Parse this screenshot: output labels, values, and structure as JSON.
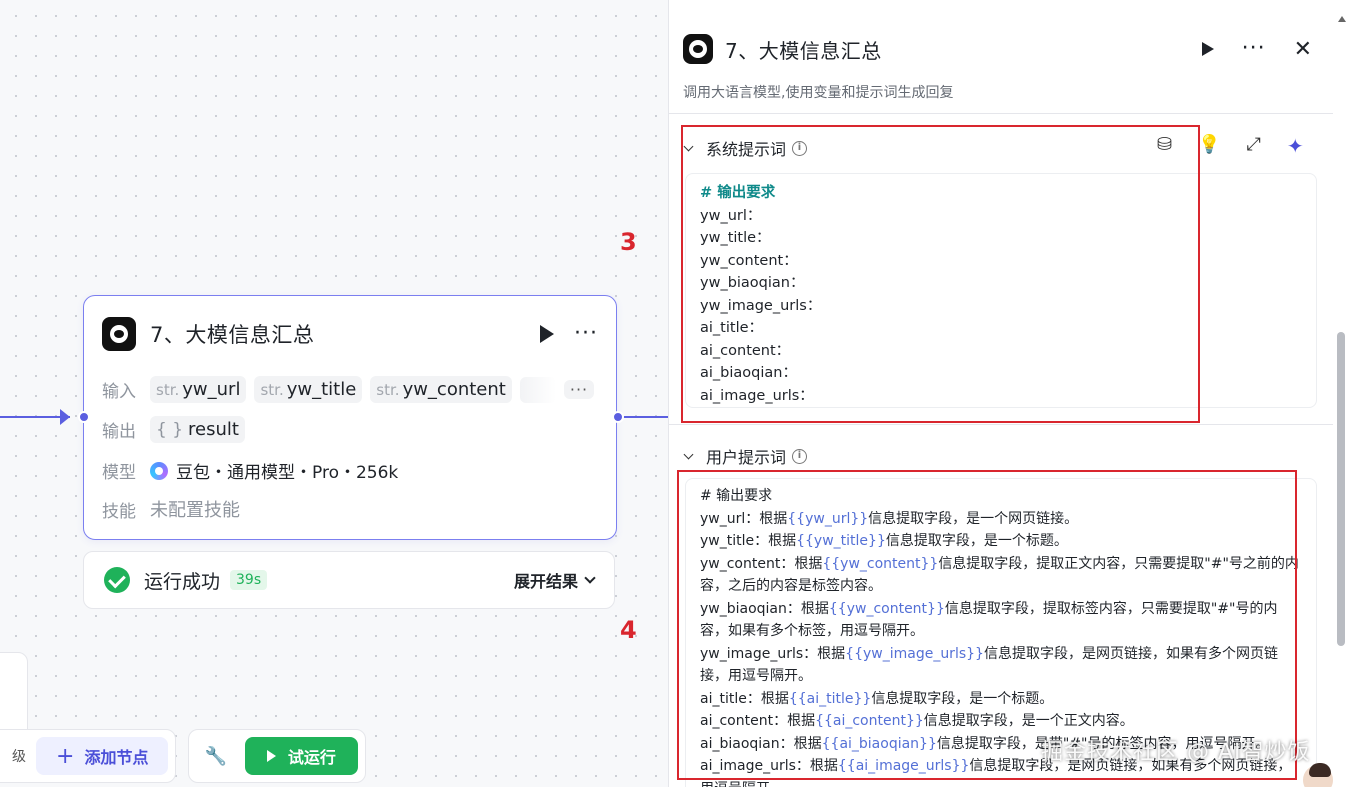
{
  "node": {
    "title": "7、大模信息汇总",
    "input_label": "输入",
    "inputs": [
      {
        "type": "str.",
        "name": "yw_url"
      },
      {
        "type": "str.",
        "name": "yw_title"
      },
      {
        "type": "str.",
        "name": "yw_content"
      }
    ],
    "more_label": "···",
    "output_label": "输出",
    "output": {
      "type": "{ }",
      "name": "result"
    },
    "model_label": "模型",
    "model_value": "豆包・通用模型・Pro・256k",
    "skill_label": "技能",
    "skill_value": "未配置技能"
  },
  "status": {
    "text": "运行成功",
    "time": "39s",
    "expand_label": "展开结果"
  },
  "toolbar": {
    "partial_label": "级",
    "add_node": "添加节点",
    "test_run": "试运行"
  },
  "annotations": {
    "a3": "3",
    "a4": "4"
  },
  "panel": {
    "title": "7、大模信息汇总",
    "description": "调用大语言模型,使用变量和提示词生成回复",
    "system_prompt_label": "系统提示词",
    "system_lines": [
      "# 输出要求",
      "yw_url：",
      "yw_title：",
      "yw_content：",
      "yw_biaoqian：",
      "yw_image_urls：",
      "ai_title：",
      "ai_content：",
      "ai_biaoqian：",
      "ai_image_urls："
    ],
    "user_prompt_label": "用户提示词",
    "user": {
      "l0": "# 输出要求",
      "l1a": "yw_url：根据",
      "l1v": "{{yw_url}}",
      "l1b": "信息提取字段，是一个网页链接。",
      "l2a": "yw_title：根据",
      "l2v": "{{yw_title}}",
      "l2b": "信息提取字段，是一个标题。",
      "l3a": "yw_content：根据",
      "l3v": "{{yw_content}}",
      "l3b": "信息提取字段，提取正文内容，只需要提取\"#\"号之前的内容，之后的内容是标签内容。",
      "l4a": "yw_biaoqian：根据",
      "l4v": "{{yw_content}}",
      "l4b": "信息提取字段，提取标签内容，只需要提取\"#\"号的内容，如果有多个标签，用逗号隔开。",
      "l5a": "yw_image_urls：根据",
      "l5v": "{{yw_image_urls}}",
      "l5b": "信息提取字段，是网页链接，如果有多个网页链接，用逗号隔开。",
      "l6a": "ai_title：根据",
      "l6v": "{{ai_title}}",
      "l6b": "信息提取字段，是一个标题。",
      "l7a": "ai_content：根据",
      "l7v": "{{ai_content}}",
      "l7b": "信息提取字段，是一个正文内容。",
      "l8a": "ai_biaoqian：根据",
      "l8v": "{{ai_biaoqian}}",
      "l8b": "信息提取字段，是带\"#\"号的标签内容，用逗号隔开。",
      "l9a": "ai_image_urls：根据",
      "l9v": "{{ai_image_urls}}",
      "l9b": "信息提取字段，是网页链接，如果有多个网页链接，用逗号隔开。"
    }
  },
  "watermark": "掘金技术社区 @ AI智炒饭",
  "colors": {
    "accent": "#5b5fe0",
    "success": "#1fb25a",
    "annotation": "#d9262e",
    "variable": "#5470d6"
  }
}
